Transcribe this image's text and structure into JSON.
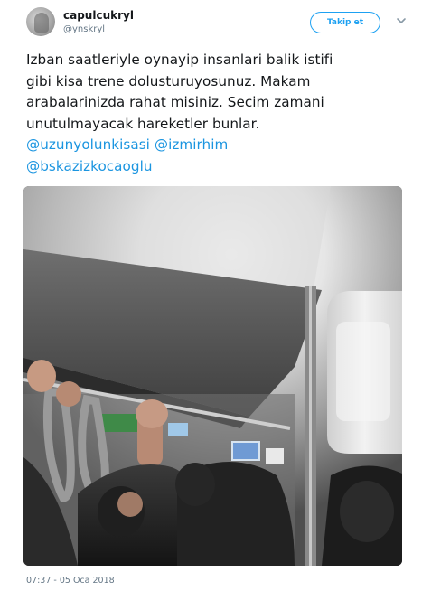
{
  "header": {
    "display_name": "capulcukryl",
    "screen_name": "@ynskryl",
    "follow_label": "Takip et"
  },
  "tweet": {
    "lines": [
      "Izban saatleriyle oynayip insanlari balik istifi",
      "gibi kisa trene dolusturuyosunuz. Makam",
      "arabalarinizda rahat misiniz. Secim zamani",
      "unutulmayacak hareketler bunlar."
    ],
    "mentions": [
      "@uzunyolunkisasi",
      "@izmirhim",
      "@bskazizkocaoglu"
    ]
  },
  "media": {
    "description": "photo of a crowded train interior"
  },
  "timestamp": "07:37 - 05 Oca 2018",
  "colors": {
    "link": "#1b95e0",
    "follow_border": "#1da1f2",
    "muted": "#657786",
    "text": "#14171a"
  }
}
